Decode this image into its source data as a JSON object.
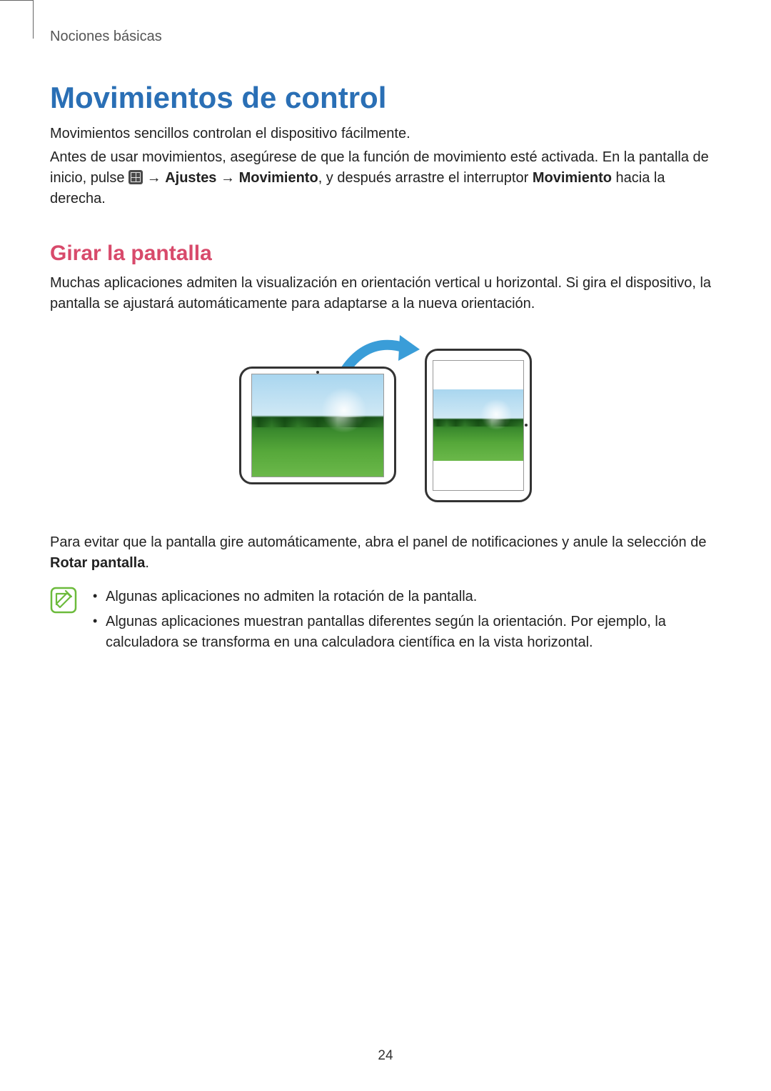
{
  "breadcrumb": "Nociones básicas",
  "title": "Movimientos de control",
  "intro1": "Movimientos sencillos controlan el dispositivo fácilmente.",
  "intro2a": "Antes de usar movimientos, asegúrese de que la función de movimiento esté activada. En la pantalla de inicio, pulse ",
  "intro2b": " → ",
  "intro2_bold1": "Ajustes",
  "intro2c": " → ",
  "intro2_bold2": "Movimiento",
  "intro2d": ", y después arrastre el interruptor ",
  "intro2_bold3": "Movimiento",
  "intro2e": " hacia la derecha.",
  "subheading": "Girar la pantalla",
  "para2": "Muchas aplicaciones admiten la visualización en orientación vertical u horizontal. Si gira el dispositivo, la pantalla se ajustará automáticamente para adaptarse a la nueva orientación.",
  "para3a": "Para evitar que la pantalla gire automáticamente, abra el panel de notificaciones y anule la selección de ",
  "para3_bold": "Rotar pantalla",
  "para3b": ".",
  "notes": {
    "item1": "Algunas aplicaciones no admiten la rotación de la pantalla.",
    "item2": "Algunas aplicaciones muestran pantallas diferentes según la orientación. Por ejemplo, la calculadora se transforma en una calculadora científica en la vista horizontal."
  },
  "page_number": "24"
}
